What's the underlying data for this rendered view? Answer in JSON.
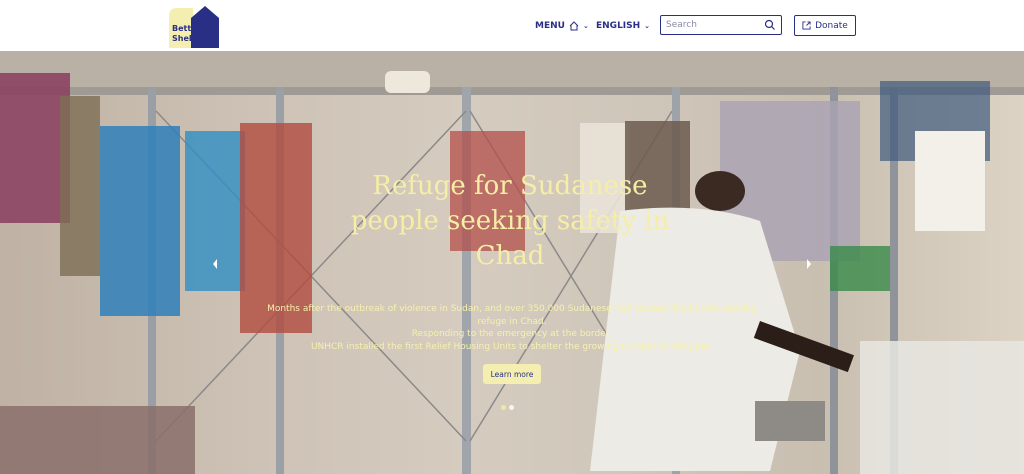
{
  "header": {
    "logo_text": "Better Shelter",
    "menu_label": "MENU",
    "language_label": "ENGLISH",
    "search_placeholder": "Search",
    "donate_label": "Donate"
  },
  "hero": {
    "title": "Refuge for Sudanese people seeking safety in Chad",
    "description_line1": "Months after the outbreak of violence in Sudan, and over 350,000 Sudanese had crossed the border seeking",
    "description_line2": "refuge in Chad.",
    "description_line3": "Responding to the emergency at the border,",
    "description_line4": "UNHCR installed the first Relief Housing Units to shelter the growing number of refugees.",
    "cta_label": "Learn more",
    "slides_count": 2,
    "active_slide": 1
  },
  "colors": {
    "brand": "#2a2f86",
    "accent": "#f4efb0"
  }
}
